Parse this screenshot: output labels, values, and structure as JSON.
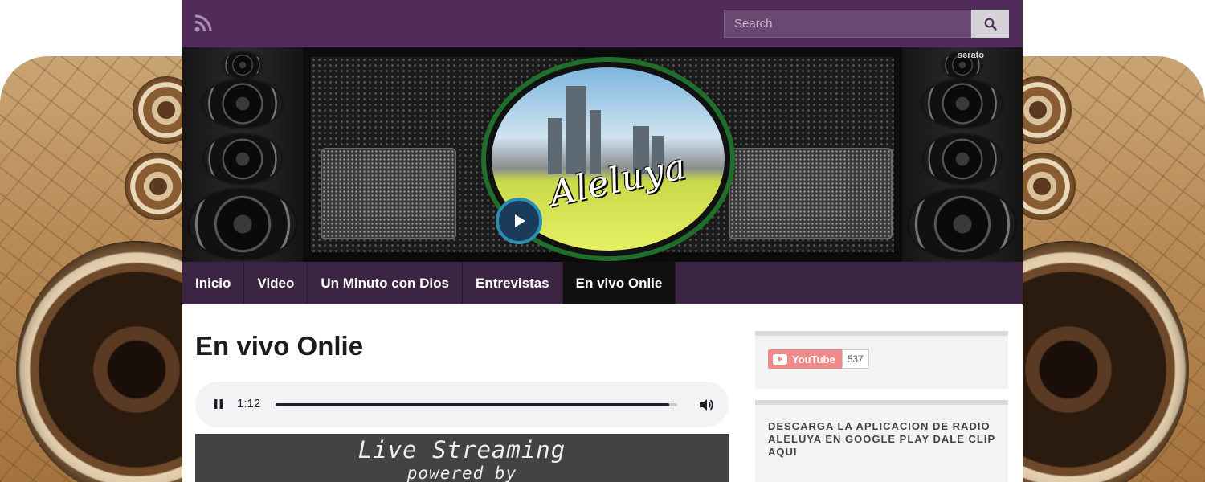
{
  "header": {
    "search": {
      "placeholder": "Search",
      "value": ""
    },
    "icons": {
      "rss": "rss-icon",
      "search": "search-icon"
    }
  },
  "banner": {
    "logo_text": "Aleluya",
    "brand_mark": "serato",
    "play_icon": "play-icon"
  },
  "nav": {
    "items": [
      {
        "label": "Inicio"
      },
      {
        "label": "Video"
      },
      {
        "label": "Un Minuto con Dios"
      },
      {
        "label": "Entrevistas"
      },
      {
        "label": "En vivo Onlie"
      }
    ],
    "active_index": 4
  },
  "main": {
    "title": "En vivo Onlie",
    "player": {
      "time": "1:12",
      "progress": 0.98,
      "state": "playing",
      "icons": {
        "pause": "pause-icon",
        "volume": "volume-icon"
      }
    },
    "stream_banner": {
      "line1": "Live Streaming",
      "line2": "powered by"
    }
  },
  "sidebar": {
    "youtube": {
      "label": "YouTube",
      "count": "537"
    },
    "promo_text": "DESCARGA LA APLICACION DE RADIO ALELUYA EN GOOGLE PLAY DALE CLIP AQUI"
  },
  "colors": {
    "topbar": "#512b5a",
    "nav": "#3c2543",
    "nav_active": "#111111",
    "youtube_button": "#ef8a8a"
  }
}
